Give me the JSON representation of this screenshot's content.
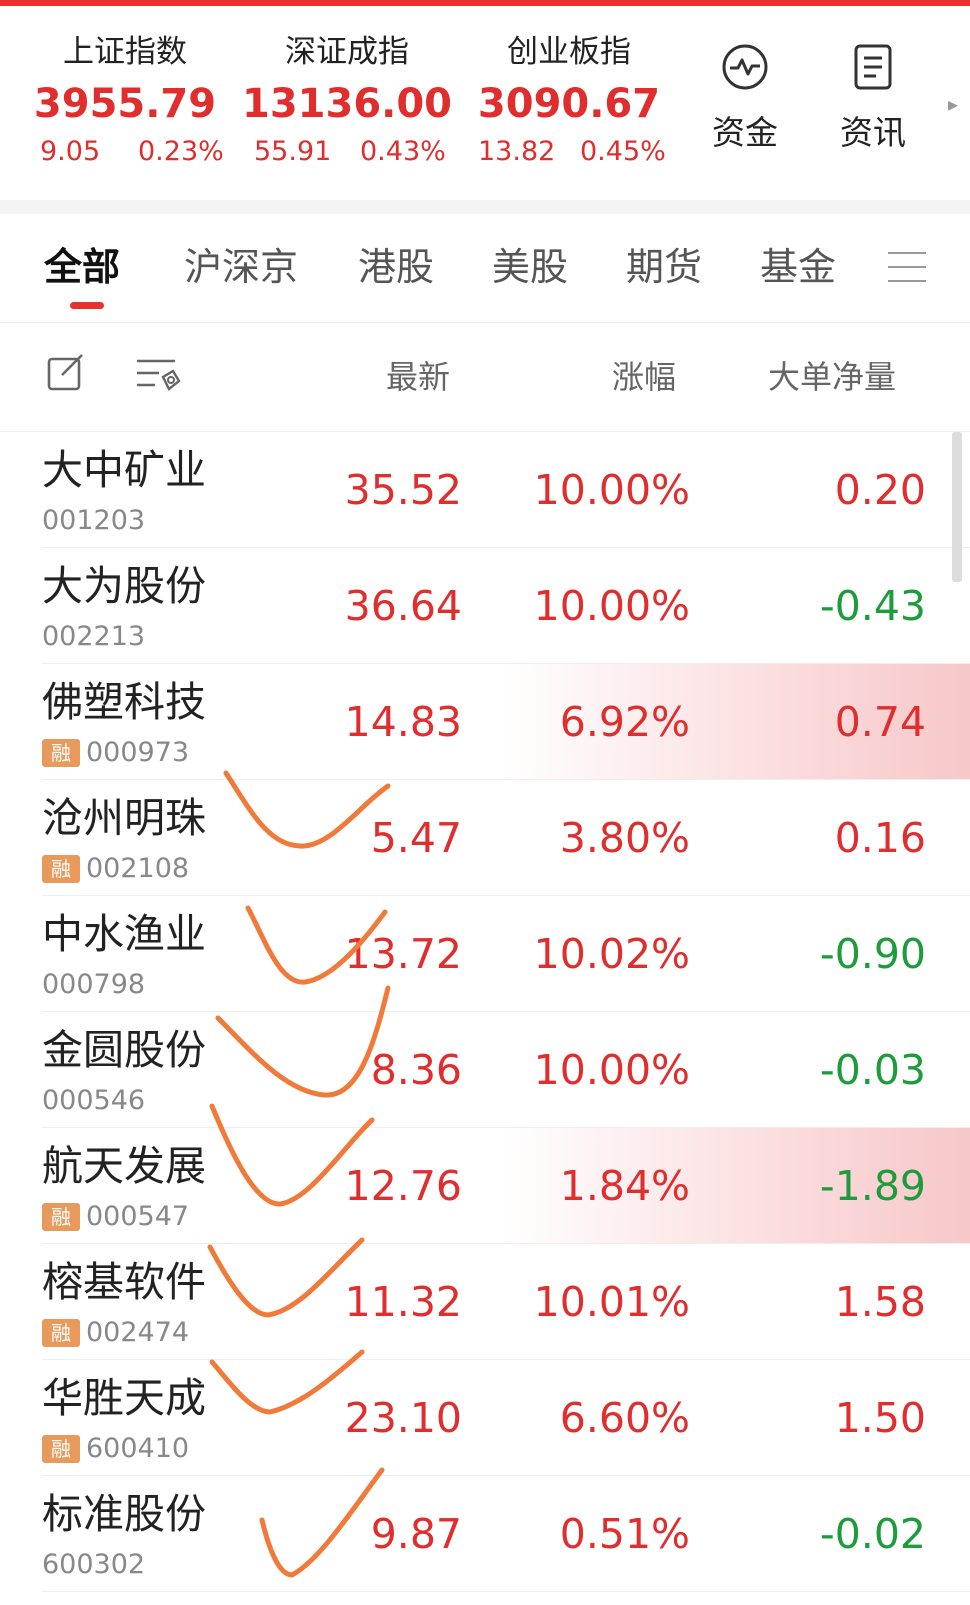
{
  "indices": [
    {
      "name": "上证指数",
      "point": "3955.79",
      "change": "9.05",
      "percent": "0.23%"
    },
    {
      "name": "深证成指",
      "point": "13136.00",
      "change": "55.91",
      "percent": "0.43%"
    },
    {
      "name": "创业板指",
      "point": "3090.67",
      "change": "13.82",
      "percent": "0.45%"
    }
  ],
  "quick_actions": {
    "funds": "资金",
    "news": "资讯"
  },
  "tabs": [
    "全部",
    "沪深京",
    "港股",
    "美股",
    "期货",
    "基金"
  ],
  "active_tab": "全部",
  "columns": {
    "latest": "最新",
    "change_pct": "涨幅",
    "big_order_net": "大单净量"
  },
  "stocks": [
    {
      "name": "大中矿业",
      "code": "001203",
      "margin": "",
      "price": "35.52",
      "pct": "10.00%",
      "net": "0.20",
      "net_dir": "up",
      "highlight": false
    },
    {
      "name": "大为股份",
      "code": "002213",
      "margin": "",
      "price": "36.64",
      "pct": "10.00%",
      "net": "-0.43",
      "net_dir": "down",
      "highlight": false
    },
    {
      "name": "佛塑科技",
      "code": "000973",
      "margin": "融",
      "price": "14.83",
      "pct": "6.92%",
      "net": "0.74",
      "net_dir": "up",
      "highlight": true
    },
    {
      "name": "沧州明珠",
      "code": "002108",
      "margin": "融",
      "price": "5.47",
      "pct": "3.80%",
      "net": "0.16",
      "net_dir": "up",
      "highlight": false
    },
    {
      "name": "中水渔业",
      "code": "000798",
      "margin": "",
      "price": "13.72",
      "pct": "10.02%",
      "net": "-0.90",
      "net_dir": "down",
      "highlight": false
    },
    {
      "name": "金圆股份",
      "code": "000546",
      "margin": "",
      "price": "8.36",
      "pct": "10.00%",
      "net": "-0.03",
      "net_dir": "down",
      "highlight": false
    },
    {
      "name": "航天发展",
      "code": "000547",
      "margin": "融",
      "price": "12.76",
      "pct": "1.84%",
      "net": "-1.89",
      "net_dir": "down",
      "highlight": true
    },
    {
      "name": "榕基软件",
      "code": "002474",
      "margin": "融",
      "price": "11.32",
      "pct": "10.01%",
      "net": "1.58",
      "net_dir": "up",
      "highlight": false
    },
    {
      "name": "华胜天成",
      "code": "600410",
      "margin": "融",
      "price": "23.10",
      "pct": "6.60%",
      "net": "1.50",
      "net_dir": "up",
      "highlight": false
    },
    {
      "name": "标准股份",
      "code": "600302",
      "margin": "",
      "price": "9.87",
      "pct": "0.51%",
      "net": "-0.02",
      "net_dir": "down",
      "highlight": false
    }
  ],
  "colors": {
    "up": "#e02d2d",
    "down": "#1e9b3c",
    "accent": "#e8312f",
    "margin_tag": "#e79a5b",
    "annotation": "#f07a3a"
  },
  "icons": {
    "funds": "pulse-chart-icon",
    "news": "document-icon",
    "edit": "edit-icon",
    "filter": "filter-icon",
    "menu": "menu-icon"
  }
}
